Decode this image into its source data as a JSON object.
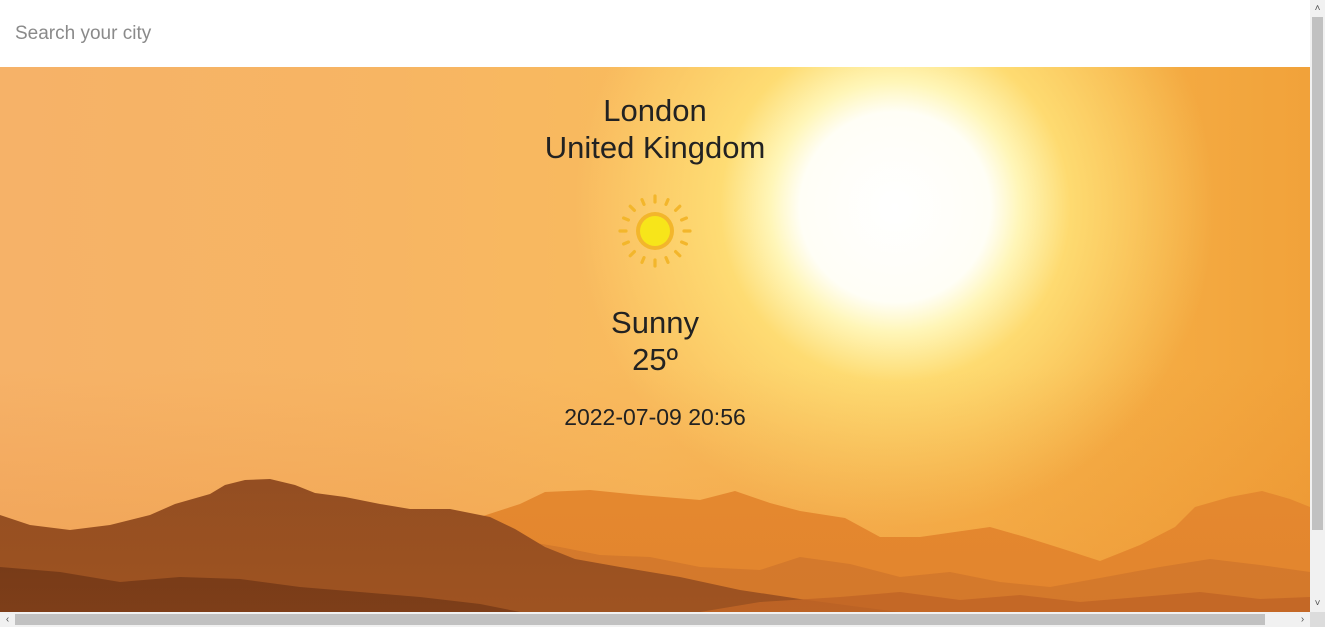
{
  "search": {
    "placeholder": "Search your city",
    "value": ""
  },
  "location": {
    "city": "London",
    "country": "United Kingdom"
  },
  "weather": {
    "icon": "sun-icon",
    "condition": "Sunny",
    "temperature": "25º",
    "datetime": "2022-07-09 20:56"
  },
  "scrollbars": {
    "up_glyph": "˄",
    "down_glyph": "˅",
    "left_glyph": "‹",
    "right_glyph": "›"
  },
  "colors": {
    "sky": "#f8b55c",
    "sun_glow": "#ffffff",
    "icon_sun": "#f5e200",
    "icon_rays": "#f3b62b",
    "text": "#222222"
  }
}
